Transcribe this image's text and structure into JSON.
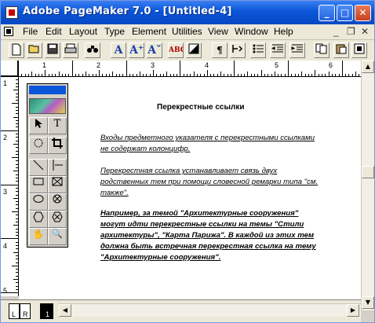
{
  "window": {
    "title": "Adobe PageMaker 7.0 - [Untitled-4]"
  },
  "titlebar_buttons": {
    "minimize": "_",
    "maximize": "□",
    "close": "✕"
  },
  "menu": [
    "File",
    "Edit",
    "Layout",
    "Type",
    "Element",
    "Utilities",
    "View",
    "Window",
    "Help"
  ],
  "mdi_buttons": {
    "minimize": "_",
    "restore": "❐",
    "close": "✕"
  },
  "toolbar": {
    "buttons": [
      "new-icon",
      "open-icon",
      "save-icon",
      "print-icon",
      "find-icon",
      "font-icon",
      "font-grow-icon",
      "font-shrink-icon",
      "spell-check-icon",
      "fill-icon",
      "paragraph-icon",
      "hyphenation-icon",
      "bullets-icon",
      "indent-left-icon",
      "indent-right-icon",
      "copy-icon",
      "paste-icon",
      "place-icon"
    ],
    "labels": {
      "font": "A",
      "font_grow": "A⁺",
      "font_shrink": "Aˇ",
      "spell": "ABC",
      "paragraph": "¶"
    }
  },
  "ruler_h": [
    "1",
    "2",
    "3",
    "4",
    "5",
    "6"
  ],
  "ruler_v": [
    "1",
    "2",
    "3",
    "4",
    "5"
  ],
  "toolbox": {
    "tools": [
      "pointer-tool-icon",
      "text-tool-icon",
      "rotate-tool-icon",
      "crop-tool-icon",
      "line-tool-icon",
      "constrained-line-tool-icon",
      "rectangle-tool-icon",
      "rectangle-frame-tool-icon",
      "ellipse-tool-icon",
      "ellipse-frame-tool-icon",
      "polygon-tool-icon",
      "polygon-frame-tool-icon",
      "hand-tool-icon",
      "zoom-tool-icon"
    ],
    "glyphs": {
      "text": "T",
      "hand": "✋",
      "zoom": "🔍"
    }
  },
  "document": {
    "heading": "Перекрестные ссылки",
    "p1": [
      "Входы предметного указателя  с перекрестными ссылками",
      "не содержат  колонцифр."
    ],
    "p2": [
      "Перекрестная ссылка устанавливает связь двух",
      "родственных тем при помощи словесной ремарки типа \"см.",
      "также\"."
    ],
    "p3": [
      "Например, за темой \"Архитектурные сооружения\"",
      "могут идти перекрестные ссылки на темы  \"Стили",
      "архитектуры\", \"Карта Парижа\". В каждой из этих тем",
      "должна быть встречная перекрестная ссылка на тему",
      "\"Архитектурные сооружения\"."
    ]
  },
  "page_tabs": {
    "left": "L",
    "right": "R",
    "page1": "1"
  }
}
